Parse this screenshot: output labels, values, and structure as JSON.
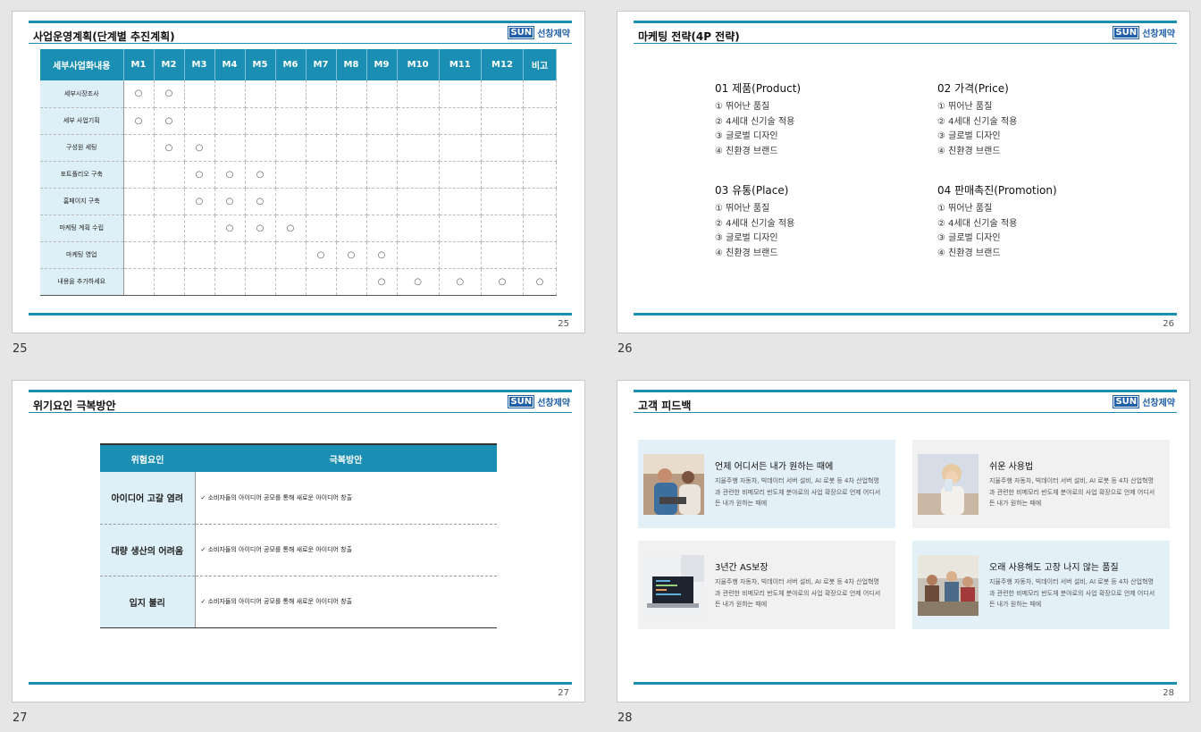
{
  "brand": {
    "box": "SUN",
    "name": "선창제약"
  },
  "slides": {
    "s25": {
      "title": "사업운영계획(단계별 추진계획)",
      "num": "25",
      "headers": [
        "세부사업화내용",
        "M1",
        "M2",
        "M3",
        "M4",
        "M5",
        "M6",
        "M7",
        "M8",
        "M9",
        "M10",
        "M11",
        "M12",
        "비고"
      ],
      "rows": [
        {
          "label": "세부시장조사",
          "marks": [
            1,
            2
          ]
        },
        {
          "label": "세부 사업기획",
          "marks": [
            1,
            2
          ]
        },
        {
          "label": "구성원 세팅",
          "marks": [
            2,
            3
          ]
        },
        {
          "label": "포트폴리오 구축",
          "marks": [
            3,
            4,
            5
          ]
        },
        {
          "label": "홈페이지 구축",
          "marks": [
            3,
            4,
            5
          ]
        },
        {
          "label": "마케팅 계획 수립",
          "marks": [
            4,
            5,
            6
          ]
        },
        {
          "label": "마케팅 영업",
          "marks": [
            7,
            8,
            9
          ]
        },
        {
          "label": "내용을 추가하세요",
          "marks": [
            9,
            10,
            11,
            12,
            13
          ]
        }
      ],
      "mark": "○"
    },
    "s26": {
      "title": "마케팅 전략(4P 전략)",
      "num": "26",
      "blocks": [
        {
          "heading": "01 제품(Product)",
          "items": [
            "①  뛰어난 품질",
            "②  4세대 신기술 적용",
            "③  글로벌 디자인",
            "④  친환경 브랜드"
          ]
        },
        {
          "heading": "02 가격(Price)",
          "items": [
            "①  뛰어난 품질",
            "②  4세대 신기술 적용",
            "③  글로벌 디자인",
            "④  친환경 브랜드"
          ]
        },
        {
          "heading": "03 유통(Place)",
          "items": [
            "①  뛰어난 품질",
            "②  4세대 신기술 적용",
            "③  글로벌 디자인",
            "④  친환경 브랜드"
          ]
        },
        {
          "heading": "04 판매촉진(Promotion)",
          "items": [
            "①  뛰어난 품질",
            "②  4세대 신기술 적용",
            "③  글로벌 디자인",
            "④  친환경 브랜드"
          ]
        }
      ]
    },
    "s27": {
      "title": "위기요인 극복방안",
      "num": "27",
      "col1": "위험요인",
      "col2": "극복방안",
      "rows": [
        {
          "risk": "아이디어 고갈 염려",
          "plan": "✓ 소비자들의 아이디어 공모를 통해 새로운 아이디어 창출"
        },
        {
          "risk": "대량 생산의 어려움",
          "plan": "✓ 소비자들의 아이디어 공모를 통해 새로운 아이디어 창출"
        },
        {
          "risk": "입지 불리",
          "plan": "✓ 소비자들의 아이디어 공모를 통해 새로운 아이디어 창출"
        }
      ]
    },
    "s28": {
      "title": "고객 피드백",
      "num": "28",
      "cards": [
        {
          "heading": "언제 어디서든 내가 원하는 때에",
          "text": "지율주행 자동차, 빅데이터 서버 설비, AI 로봇 등 4차 산업혁명과 관련한 비메모리 반도체 분야로의 사업 확장으로 언제 어디서든 내가 원하는 때에"
        },
        {
          "heading": "쉬운 사용법",
          "text": "지율주행 자동차, 빅데이터 서버 설비, AI 로봇 등 4차 산업혁명과 관련한 비메모리 반도체 분야로의 사업 확장으로 언제 어디서든 내가 원하는 때에"
        },
        {
          "heading": "3년간 AS보장",
          "text": "지율주행 자동차, 빅데이터 서버 설비, AI 로봇 등 4차 산업혁명과 관련한 비메모리 반도체 분야로의 사업 확장으로 언제 어디서든 내가 원하는 때에"
        },
        {
          "heading": "오래 사용해도 고장 나지 않는 품질",
          "text": "지율주행 자동차, 빅데이터 서버 설비, AI 로봇 등 4차 산업혁명과 관련한 비메모리 반도체 분야로의 사업 확장으로 언제 어디서든 내가 원하는 때에"
        }
      ]
    }
  },
  "colors": {
    "accent": "#1a8fb3",
    "logo": "#1f5fa8",
    "cellBlue": "#ddeff7"
  }
}
